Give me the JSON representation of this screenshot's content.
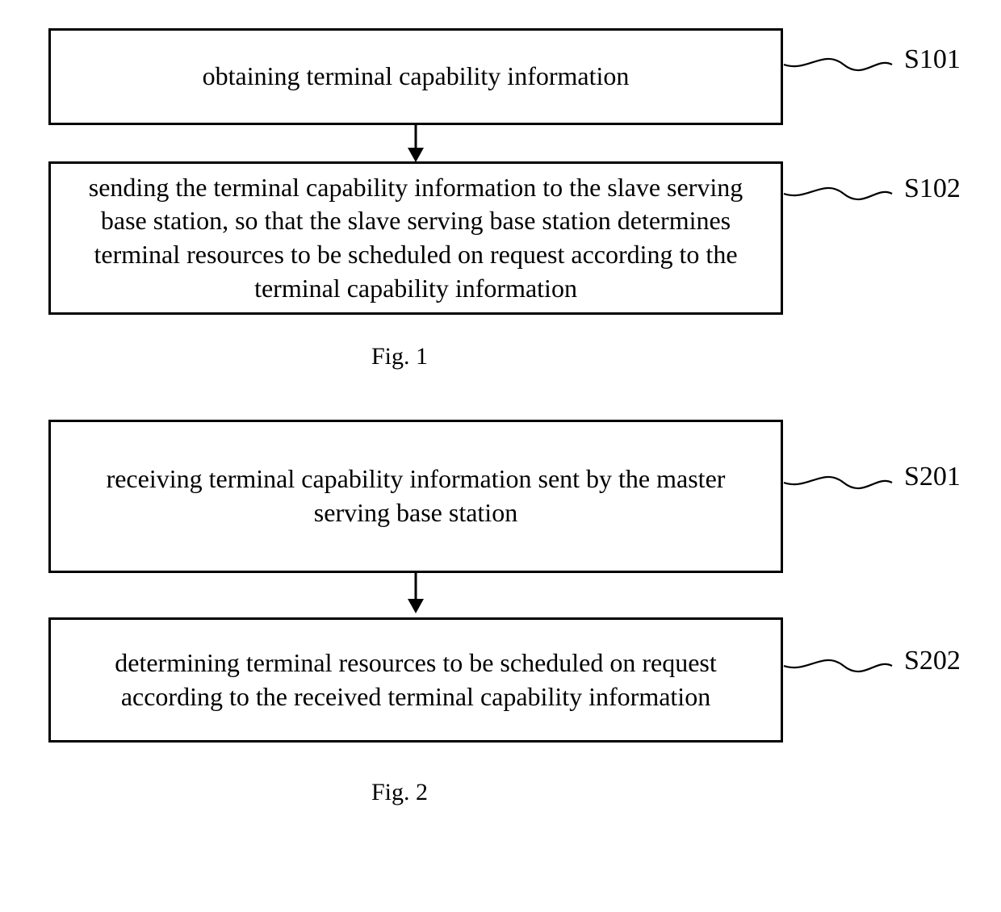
{
  "fig1": {
    "caption": "Fig. 1",
    "steps": [
      {
        "id": "S101",
        "text": "obtaining terminal capability information"
      },
      {
        "id": "S102",
        "text": "sending the terminal capability information to the slave serving base station, so that the slave serving base station determines terminal resources to be scheduled on request according to the terminal capability information"
      }
    ]
  },
  "fig2": {
    "caption": "Fig. 2",
    "steps": [
      {
        "id": "S201",
        "text": "receiving terminal capability information sent by the master serving base station"
      },
      {
        "id": "S202",
        "text": "determining terminal resources to be scheduled on request according to the received terminal capability information"
      }
    ]
  }
}
